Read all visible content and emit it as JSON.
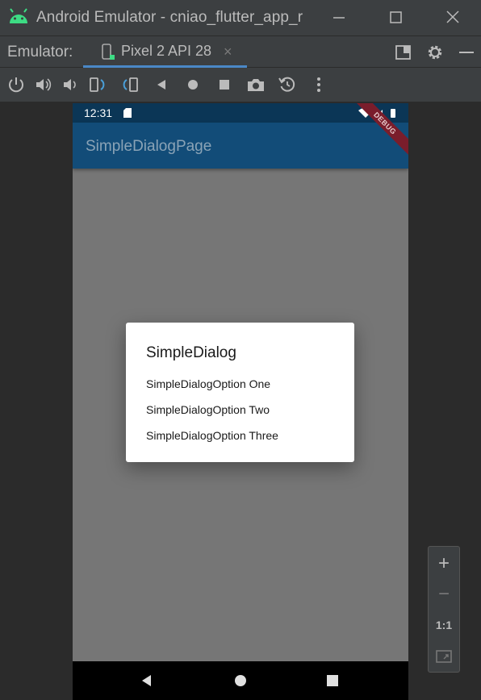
{
  "window": {
    "title": "Android Emulator - cniao_flutter_app_r"
  },
  "tabbar": {
    "label": "Emulator:",
    "device_tab": "Pixel 2 API 28",
    "close_glyph": "×"
  },
  "status": {
    "time": "12:31"
  },
  "app": {
    "title": "SimpleDialogPage",
    "debug_banner": "DEBUG",
    "dialog": {
      "title": "SimpleDialog",
      "options": [
        "SimpleDialogOption One",
        "SimpleDialogOption Two",
        "SimpleDialogOption Three"
      ]
    }
  },
  "zoom": {
    "zoom_in": "+",
    "zoom_out": "−",
    "actual": "1:1"
  },
  "colors": {
    "appbar": "#124c78",
    "statusbar": "#0b3656",
    "tab_accent": "#4a88c7",
    "debug": "#7a1d2b",
    "android_green": "#3ddc84"
  }
}
